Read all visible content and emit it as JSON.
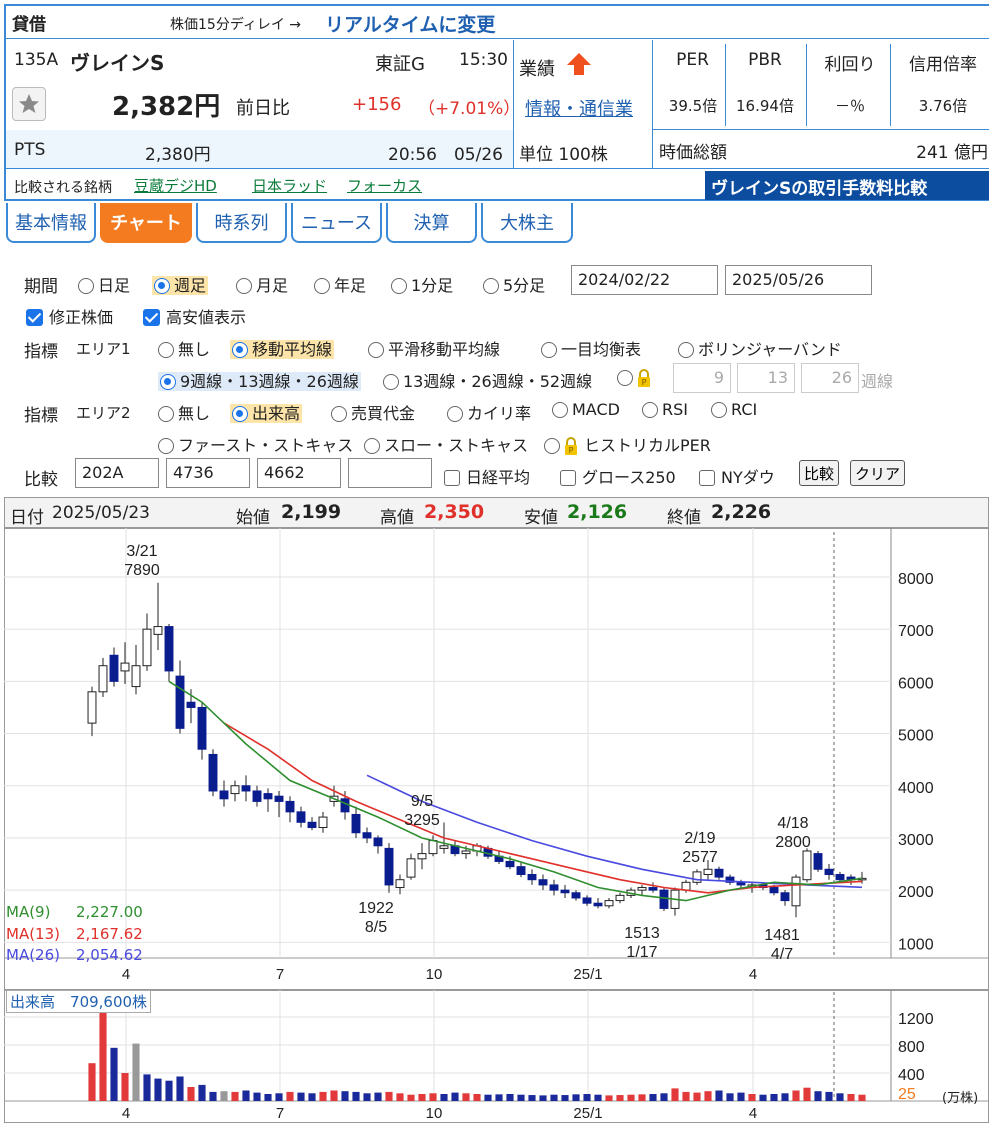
{
  "header": {
    "tag": "貸借",
    "delay_note": "株価15分ディレイ →",
    "realtime_link": "リアルタイムに変更"
  },
  "stock": {
    "code": "135A",
    "name": "ヴレインS",
    "market": "東証G",
    "time": "15:30",
    "price": "2,382円",
    "change_label": "前日比",
    "change": "+156",
    "change_pct": "（+7.01%）",
    "pts_label": "PTS",
    "pts_price": "2,380円",
    "pts_time": "20:56　05/26",
    "compare_label": "比較される銘柄",
    "compare_links": [
      "豆蔵デジHD",
      "日本ラッド",
      "フォーカス"
    ],
    "fee_banner": "ヴレインSの取引手数料比較"
  },
  "business": {
    "label": "業績",
    "sector": "情報・通信業",
    "unit": "単位 100株"
  },
  "metrics": [
    {
      "label": "PER",
      "value": "39.5倍"
    },
    {
      "label": "PBR",
      "value": "16.94倍"
    },
    {
      "label": "利回り",
      "value": "－％"
    },
    {
      "label": "信用倍率",
      "value": "3.76倍"
    }
  ],
  "market_cap": {
    "label": "時価総額",
    "value": "241 億円"
  },
  "tabs": [
    "基本情報",
    "チャート",
    "時系列",
    "ニュース",
    "決算",
    "大株主"
  ],
  "settings": {
    "period_label": "期間",
    "periods": [
      "日足",
      "週足",
      "月足",
      "年足",
      "1分足",
      "5分足"
    ],
    "date_from": "2024/02/22",
    "date_to": "2025/05/26",
    "adjusted": "修正株価",
    "hilo": "高安値表示",
    "indicator_label": "指標",
    "area1": "エリア1",
    "area1_opts": [
      "無し",
      "移動平均線",
      "平滑移動平均線",
      "一目均衡表",
      "ボリンジャーバンド"
    ],
    "ma_opts": [
      "9週線・13週線・26週線",
      "13週線・26週線・52週線"
    ],
    "custom_ma": [
      "9",
      "13",
      "26"
    ],
    "custom_unit": "週線",
    "area2": "エリア2",
    "area2_opts": [
      "無し",
      "出来高",
      "売買代金",
      "カイリ率",
      "MACD",
      "RSI",
      "RCI"
    ],
    "area2_opts2": [
      "ファースト・ストキャス",
      "スロー・ストキャス",
      "ヒストリカルPER"
    ],
    "compare_label": "比較",
    "compare_codes": [
      "202A",
      "4736",
      "4662",
      ""
    ],
    "compare_checks": [
      "日経平均",
      "グロース250",
      "NYダウ"
    ],
    "compare_btn": "比較",
    "clear_btn": "クリア"
  },
  "ohlc_bar": {
    "date_label": "日付",
    "date": "2025/05/23",
    "open_label": "始値",
    "open": "2,199",
    "high_label": "高値",
    "high": "2,350",
    "low_label": "安値",
    "low": "2,126",
    "close_label": "終値",
    "close": "2,226"
  },
  "colors": {
    "up": "#ffffff",
    "down": "#0a1d8f",
    "ma9": "#2f8f2f",
    "ma13": "#e0302a",
    "ma26": "#4a4ae0",
    "vol_up": "#e23a3a",
    "vol_down": "#1a2a9a",
    "accent": "#f47b20",
    "border": "#3a8ad6"
  },
  "chart_data": [
    {
      "type": "candlestick",
      "title": "",
      "ylim": [
        700,
        8900
      ],
      "yticks": [
        1000,
        2000,
        3000,
        4000,
        5000,
        6000,
        7000,
        8000
      ],
      "xticks": [
        "4",
        "7",
        "10",
        "25/1",
        "4"
      ],
      "ma_legend": [
        {
          "name": "MA(9)",
          "value": "2,227.00"
        },
        {
          "name": "MA(13)",
          "value": "2,167.62"
        },
        {
          "name": "MA(26)",
          "value": "2,054.62"
        }
      ],
      "annotations": [
        {
          "date": "3/21",
          "value": "7890"
        },
        {
          "date": "8/5",
          "value": "1922"
        },
        {
          "date": "9/5",
          "value": "3295"
        },
        {
          "date": "1/17",
          "value": "1513"
        },
        {
          "date": "2/19",
          "value": "2577"
        },
        {
          "date": "4/18",
          "value": "2800"
        },
        {
          "date": "4/7",
          "value": "1481"
        }
      ],
      "candles": [
        [
          5200,
          5900,
          4950,
          5800
        ],
        [
          5800,
          6450,
          5700,
          6300
        ],
        [
          6500,
          6650,
          5900,
          6000
        ],
        [
          6200,
          6750,
          5950,
          6350
        ],
        [
          5900,
          6700,
          5750,
          6300
        ],
        [
          6300,
          7300,
          6200,
          7000
        ],
        [
          6900,
          7890,
          6600,
          7050
        ],
        [
          7050,
          7100,
          6000,
          6200
        ],
        [
          6100,
          6400,
          5000,
          5100
        ],
        [
          5600,
          5850,
          5200,
          5500
        ],
        [
          5500,
          5600,
          4500,
          4700
        ],
        [
          4600,
          4700,
          3800,
          3900
        ],
        [
          3900,
          4100,
          3600,
          3750
        ],
        [
          3850,
          4100,
          3700,
          4000
        ],
        [
          4000,
          4200,
          3700,
          3900
        ],
        [
          3900,
          4000,
          3600,
          3700
        ],
        [
          3850,
          3950,
          3500,
          3750
        ],
        [
          3800,
          3900,
          3400,
          3700
        ],
        [
          3700,
          3800,
          3300,
          3500
        ],
        [
          3500,
          3600,
          3200,
          3300
        ],
        [
          3300,
          3400,
          3150,
          3200
        ],
        [
          3200,
          3500,
          3100,
          3400
        ],
        [
          3700,
          4000,
          3600,
          3800
        ],
        [
          3750,
          3900,
          3350,
          3500
        ],
        [
          3450,
          3600,
          3000,
          3100
        ],
        [
          3100,
          3200,
          2900,
          3000
        ],
        [
          3000,
          3050,
          2700,
          2850
        ],
        [
          2800,
          2900,
          1950,
          2100
        ],
        [
          2050,
          2300,
          1922,
          2200
        ],
        [
          2250,
          2700,
          2200,
          2600
        ],
        [
          2600,
          2900,
          2400,
          2700
        ],
        [
          2700,
          3050,
          2650,
          2950
        ],
        [
          2800,
          3295,
          2700,
          2850
        ],
        [
          2850,
          2950,
          2650,
          2700
        ],
        [
          2700,
          2850,
          2600,
          2750
        ],
        [
          2750,
          2900,
          2650,
          2850
        ],
        [
          2800,
          2850,
          2600,
          2650
        ],
        [
          2650,
          2750,
          2500,
          2550
        ],
        [
          2550,
          2650,
          2400,
          2450
        ],
        [
          2450,
          2550,
          2250,
          2300
        ],
        [
          2300,
          2400,
          2100,
          2200
        ],
        [
          2200,
          2300,
          2000,
          2100
        ],
        [
          2100,
          2200,
          1900,
          2000
        ],
        [
          2000,
          2100,
          1850,
          1950
        ],
        [
          1950,
          2000,
          1800,
          1850
        ],
        [
          1850,
          1900,
          1700,
          1750
        ],
        [
          1750,
          1850,
          1650,
          1700
        ],
        [
          1700,
          1850,
          1650,
          1800
        ],
        [
          1800,
          1950,
          1750,
          1900
        ],
        [
          1900,
          2050,
          1850,
          2000
        ],
        [
          2000,
          2100,
          1900,
          2050
        ],
        [
          2050,
          2150,
          1950,
          2000
        ],
        [
          2000,
          2050,
          1600,
          1650
        ],
        [
          1650,
          2050,
          1513,
          2000
        ],
        [
          2000,
          2200,
          1950,
          2150
        ],
        [
          2150,
          2400,
          2100,
          2350
        ],
        [
          2300,
          2577,
          2200,
          2400
        ],
        [
          2400,
          2450,
          2200,
          2250
        ],
        [
          2250,
          2300,
          2100,
          2150
        ],
        [
          2150,
          2200,
          2050,
          2100
        ],
        [
          2050,
          2150,
          1950,
          2100
        ],
        [
          2100,
          2150,
          2000,
          2050
        ],
        [
          2050,
          2100,
          1900,
          1950
        ],
        [
          1950,
          2000,
          1700,
          1800
        ],
        [
          1700,
          2300,
          1481,
          2250
        ],
        [
          2200,
          2800,
          2150,
          2750
        ],
        [
          2700,
          2750,
          2350,
          2400
        ],
        [
          2400,
          2500,
          2200,
          2300
        ],
        [
          2300,
          2350,
          2150,
          2200
        ],
        [
          2250,
          2300,
          2100,
          2200
        ],
        [
          2199,
          2350,
          2126,
          2226
        ]
      ],
      "ma9_points": [
        [
          7,
          6000
        ],
        [
          10,
          5600
        ],
        [
          14,
          4800
        ],
        [
          18,
          4100
        ],
        [
          22,
          3750
        ],
        [
          26,
          3400
        ],
        [
          30,
          3000
        ],
        [
          34,
          2800
        ],
        [
          38,
          2600
        ],
        [
          42,
          2350
        ],
        [
          46,
          2050
        ],
        [
          50,
          1900
        ],
        [
          54,
          1800
        ],
        [
          58,
          2000
        ],
        [
          62,
          2150
        ],
        [
          66,
          2100
        ],
        [
          70,
          2227
        ]
      ],
      "ma13_points": [
        [
          12,
          5200
        ],
        [
          16,
          4700
        ],
        [
          20,
          4100
        ],
        [
          24,
          3700
        ],
        [
          28,
          3350
        ],
        [
          32,
          3000
        ],
        [
          36,
          2800
        ],
        [
          40,
          2600
        ],
        [
          44,
          2400
        ],
        [
          48,
          2200
        ],
        [
          52,
          2050
        ],
        [
          56,
          1950
        ],
        [
          60,
          2050
        ],
        [
          64,
          2100
        ],
        [
          70,
          2168
        ]
      ],
      "ma26_points": [
        [
          25,
          4200
        ],
        [
          30,
          3700
        ],
        [
          35,
          3300
        ],
        [
          40,
          2950
        ],
        [
          45,
          2650
        ],
        [
          50,
          2400
        ],
        [
          55,
          2200
        ],
        [
          60,
          2150
        ],
        [
          65,
          2100
        ],
        [
          70,
          2055
        ]
      ]
    },
    {
      "type": "bar",
      "title": "出来高",
      "label_value": "709,600株",
      "unit": "(万株)",
      "ylim": [
        0,
        1500
      ],
      "yticks": [
        1200,
        800,
        400
      ],
      "low_tick": "25",
      "xticks": [
        "4",
        "7",
        "10",
        "25/1",
        "4"
      ],
      "values": [
        540,
        1350,
        760,
        400,
        820,
        380,
        320,
        290,
        350,
        200,
        230,
        130,
        140,
        130,
        150,
        120,
        100,
        110,
        130,
        120,
        110,
        130,
        150,
        140,
        130,
        110,
        120,
        130,
        110,
        90,
        100,
        110,
        100,
        120,
        110,
        100,
        90,
        95,
        100,
        90,
        85,
        80,
        90,
        85,
        95,
        100,
        90,
        80,
        85,
        90,
        95,
        100,
        110,
        180,
        130,
        120,
        140,
        150,
        110,
        120,
        100,
        90,
        100,
        110,
        150,
        190,
        140,
        130,
        110,
        100,
        90
      ],
      "up_flags": [
        1,
        1,
        0,
        1,
        1,
        0,
        0,
        0,
        0,
        1,
        0,
        0,
        1,
        1,
        0,
        0,
        0,
        0,
        1,
        0,
        0,
        1,
        1,
        0,
        0,
        0,
        0,
        1,
        1,
        1,
        1,
        1,
        0,
        0,
        1,
        1,
        0,
        0,
        0,
        0,
        0,
        0,
        0,
        0,
        0,
        0,
        0,
        1,
        1,
        1,
        1,
        0,
        0,
        1,
        1,
        1,
        1,
        0,
        0,
        0,
        1,
        0,
        0,
        0,
        1,
        1,
        0,
        0,
        0,
        1,
        1
      ],
      "gray_index": [
        4,
        12
      ]
    }
  ]
}
